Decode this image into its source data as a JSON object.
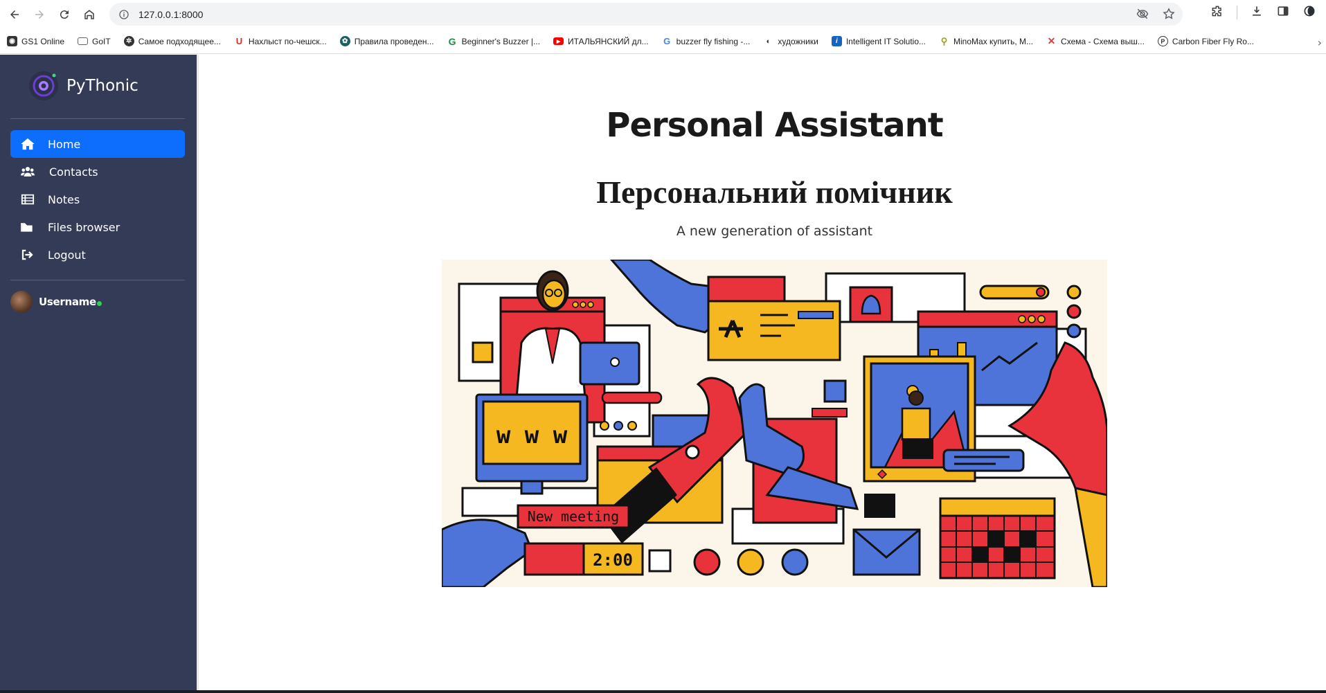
{
  "browser": {
    "url": "127.0.0.1:8000",
    "bookmarks": [
      {
        "label": "GS1 Online",
        "icon": "globe-icon",
        "color": "#333333"
      },
      {
        "label": "GoIT",
        "icon": "folder-icon",
        "color": "#5f6368"
      },
      {
        "label": "Самое подходящее...",
        "icon": "gear-icon",
        "color": "#333333"
      },
      {
        "label": "Нахлыст по-чешск...",
        "icon": "magnet-icon",
        "color": "#d93025"
      },
      {
        "label": "Правила проведен...",
        "icon": "leaf-icon",
        "color": "#1a5f5f"
      },
      {
        "label": "Beginner's Buzzer |...",
        "icon": "g-icon",
        "color": "#1e8e3e"
      },
      {
        "label": "ИТАЛЬЯНСКИЙ дл...",
        "icon": "youtube-icon",
        "color": "#ff0000"
      },
      {
        "label": "buzzer fly fishing -...",
        "icon": "google-icon",
        "color": "#4285f4"
      },
      {
        "label": "художники",
        "icon": "eye-icon",
        "color": "#333333"
      },
      {
        "label": "Intelligent IT Solutio...",
        "icon": "i-icon",
        "color": "#1565c0"
      },
      {
        "label": "MinoMax купить, М...",
        "icon": "bug-icon",
        "color": "#9e9d24"
      },
      {
        "label": "Схема - Схема выш...",
        "icon": "x-icon",
        "color": "#e53935"
      },
      {
        "label": "Carbon Fiber Fly Ro...",
        "icon": "p-icon",
        "color": "#333333"
      }
    ]
  },
  "sidebar": {
    "brand": "PyThonic",
    "items": [
      {
        "label": "Home",
        "icon": "home-icon",
        "active": true
      },
      {
        "label": "Contacts",
        "icon": "users-icon",
        "active": false
      },
      {
        "label": "Notes",
        "icon": "list-icon",
        "active": false
      },
      {
        "label": "Files browser",
        "icon": "folder-icon",
        "active": false
      },
      {
        "label": "Logout",
        "icon": "logout-icon",
        "active": false
      }
    ],
    "user": {
      "name": "Username",
      "status_color": "#2bd64a"
    }
  },
  "main": {
    "title": "Personal Assistant",
    "title_uk": "Персональний помічник",
    "subtitle": "A new generation of assistant",
    "illustration": {
      "screen_text": "w w w",
      "meeting_label": "New meeting",
      "time": "2:00"
    }
  },
  "colors": {
    "sidebar_bg": "#343b56",
    "active_bg": "#0d6efd",
    "accent_red": "#e8323c",
    "accent_blue": "#4f74d9",
    "accent_yellow": "#f5b820"
  }
}
